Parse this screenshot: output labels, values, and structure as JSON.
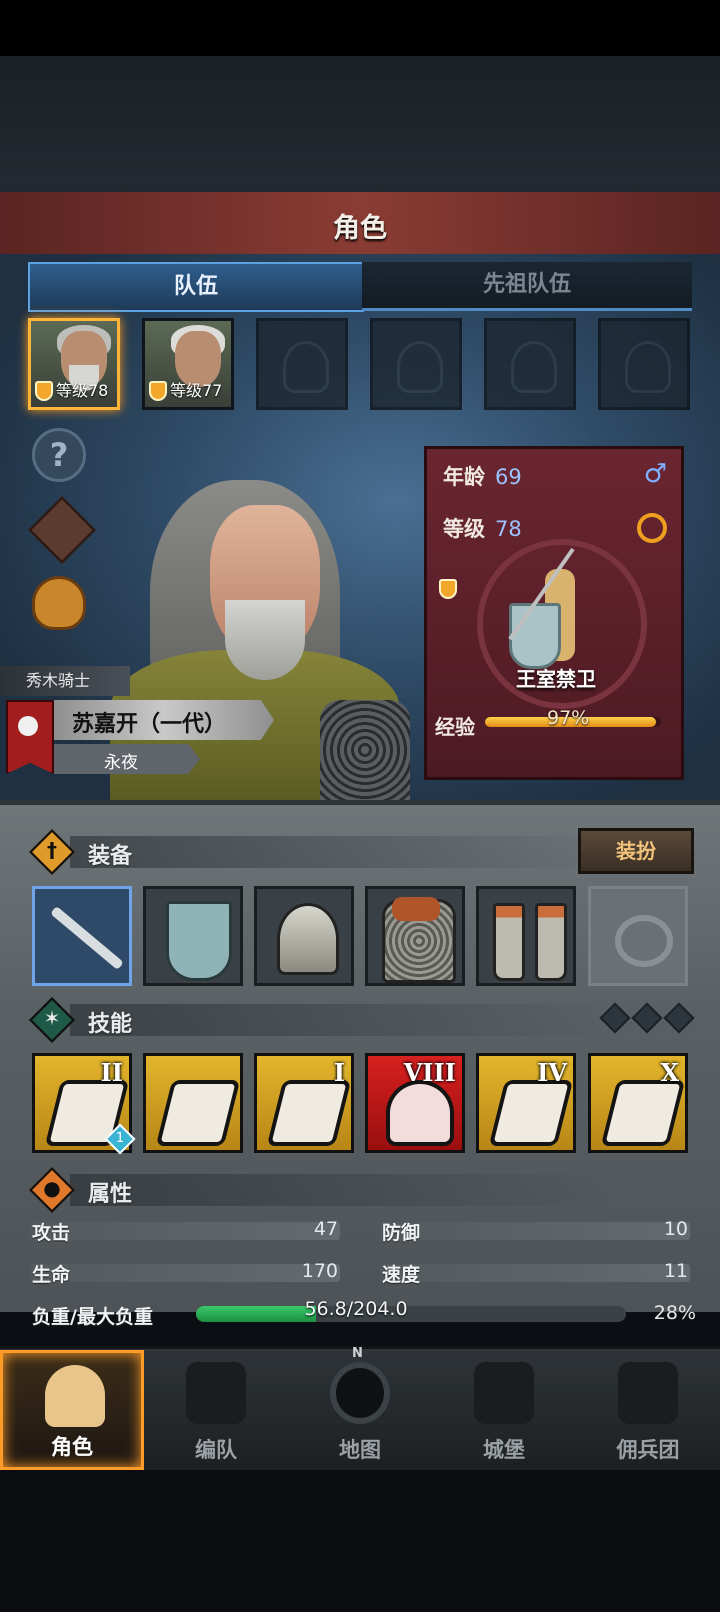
{
  "header": {
    "title": "角色"
  },
  "tabs": [
    {
      "label": "队伍"
    },
    {
      "label": "先祖队伍"
    }
  ],
  "party": [
    {
      "level_text": "等级78"
    },
    {
      "level_text": "等级77"
    }
  ],
  "hero": {
    "class_name": "秀木骑士",
    "name": "苏嘉开（一代）",
    "title": "永夜"
  },
  "info_card": {
    "age_label": "年龄",
    "age_value": "69",
    "level_label": "等级",
    "level_value": "78",
    "unit_name": "王室禁卫",
    "exp_label": "经验",
    "exp_value": "97%",
    "exp_fraction": 0.97,
    "gender_glyph": "♂"
  },
  "equipment": {
    "title": "装备",
    "dress_button": "装扮",
    "slots": [
      "sword",
      "shield",
      "helmet",
      "armor",
      "boots",
      "ring"
    ]
  },
  "skills": {
    "title": "技能",
    "items": [
      {
        "rank": "II",
        "badge": "1"
      },
      {
        "rank": ""
      },
      {
        "rank": "I"
      },
      {
        "rank": "VIII"
      },
      {
        "rank": "IV"
      },
      {
        "rank": "X"
      }
    ]
  },
  "attributes": {
    "title": "属性",
    "attack_label": "攻击",
    "attack_value": "47",
    "defense_label": "防御",
    "defense_value": "10",
    "hp_label": "生命",
    "hp_value": "170",
    "speed_label": "速度",
    "speed_value": "11",
    "load_label": "负重/最大负重",
    "load_text": "56.8/204.0",
    "load_pct": "28%",
    "load_fraction": 0.28
  },
  "nav": {
    "items": [
      {
        "label": "角色"
      },
      {
        "label": "编队"
      },
      {
        "label": "地图"
      },
      {
        "label": "城堡"
      },
      {
        "label": "佣兵团"
      }
    ],
    "compass_letter": "N"
  }
}
